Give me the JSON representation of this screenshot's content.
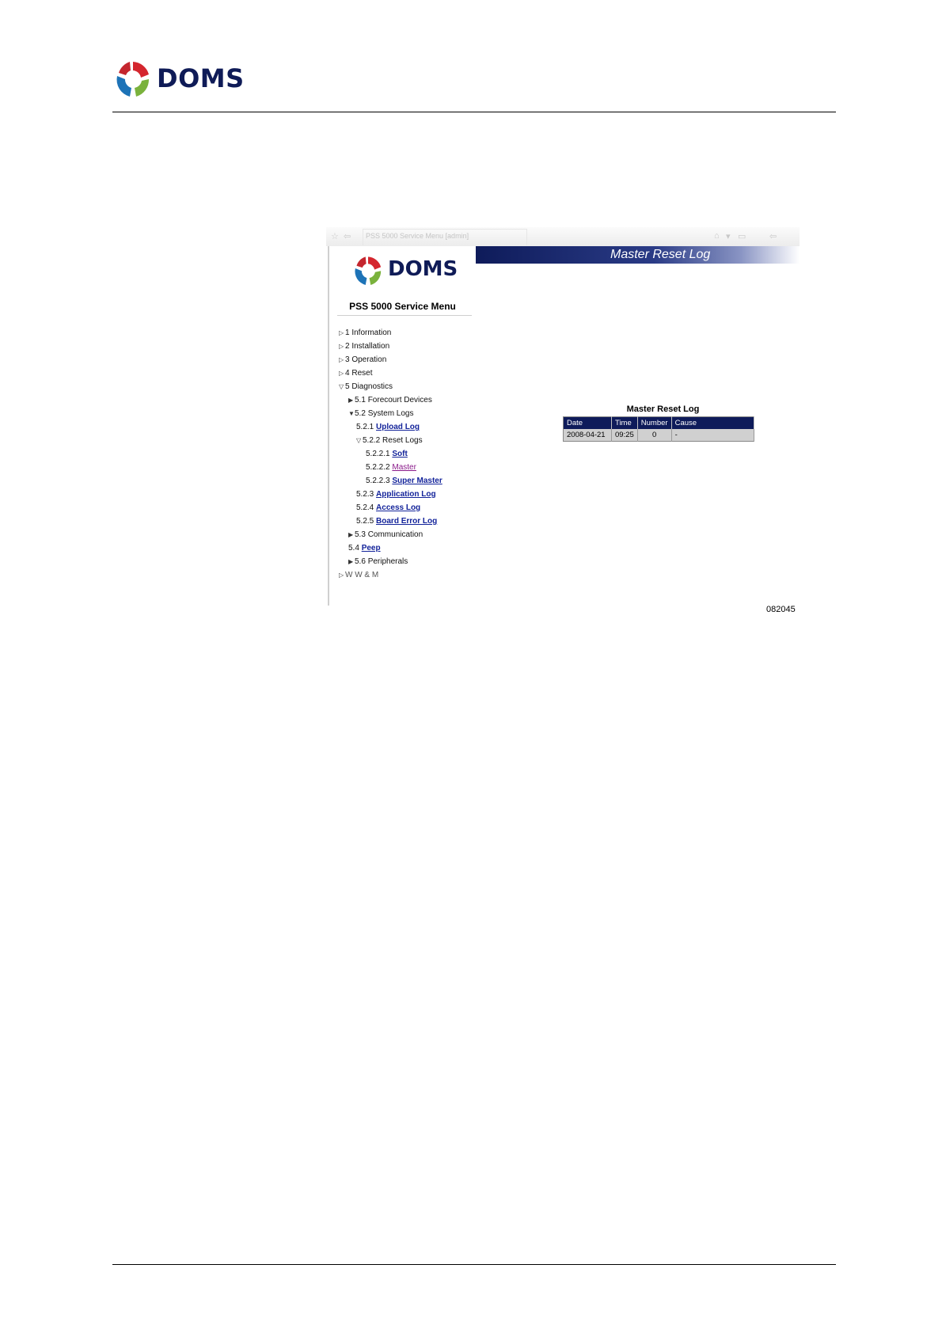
{
  "brand": {
    "name": "DOMS",
    "colors": {
      "red": "#d4262e",
      "green": "#7ab23c",
      "blue": "#1d73b7",
      "navy": "#0f1b57"
    }
  },
  "browser": {
    "tab_title": "PSS 5000 Service Menu [admin]"
  },
  "sidebar": {
    "menu_title": "PSS 5000 Service Menu",
    "items": [
      {
        "num": "1",
        "label": "Information"
      },
      {
        "num": "2",
        "label": "Installation"
      },
      {
        "num": "3",
        "label": "Operation"
      },
      {
        "num": "4",
        "label": "Reset"
      },
      {
        "num": "5",
        "label": "Diagnostics"
      },
      {
        "num": "5.1",
        "label": "Forecourt Devices"
      },
      {
        "num": "5.2",
        "label": "System Logs"
      },
      {
        "num": "5.2.1",
        "label": "Upload Log"
      },
      {
        "num": "5.2.2",
        "label": "Reset Logs"
      },
      {
        "num": "5.2.2.1",
        "label": "Soft"
      },
      {
        "num": "5.2.2.2",
        "label": "Master"
      },
      {
        "num": "5.2.2.3",
        "label": "Super Master"
      },
      {
        "num": "5.2.3",
        "label": "Application Log"
      },
      {
        "num": "5.2.4",
        "label": "Access Log"
      },
      {
        "num": "5.2.5",
        "label": "Board Error Log"
      },
      {
        "num": "5.3",
        "label": "Communication"
      },
      {
        "num": "5.4",
        "label": "Peep"
      },
      {
        "num": "5.6",
        "label": "Peripherals"
      },
      {
        "num": "",
        "label": "W W & M"
      }
    ]
  },
  "content": {
    "title": "Master Reset Log",
    "table_caption": "Master Reset Log",
    "columns": [
      "Date",
      "Time",
      "Number",
      "Cause"
    ],
    "rows": [
      [
        "2008-04-21",
        "09:25",
        "0",
        "-"
      ]
    ]
  },
  "figure_number": "082045"
}
